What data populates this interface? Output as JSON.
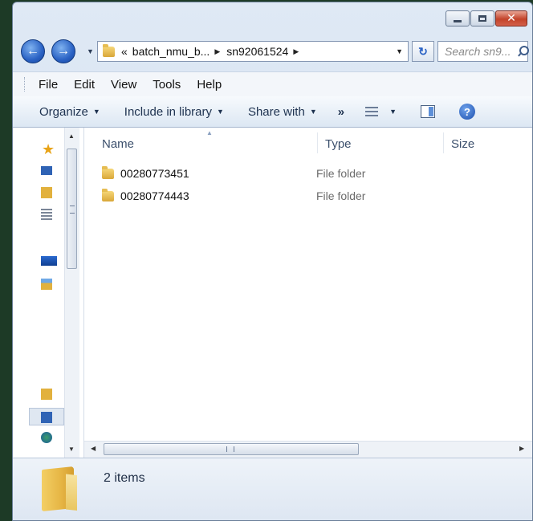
{
  "nav": {
    "back_label": "Back",
    "forward_label": "Forward",
    "breadcrumb_overflow": "«",
    "breadcrumbs": [
      "batch_nmu_b...",
      "sn92061524"
    ],
    "search_placeholder": "Search sn9..."
  },
  "menu": [
    "File",
    "Edit",
    "View",
    "Tools",
    "Help"
  ],
  "toolbar": {
    "organize": "Organize",
    "include_in_library": "Include in library",
    "share_with": "Share with",
    "more": "»"
  },
  "columns": {
    "name": "Name",
    "type": "Type",
    "size": "Size"
  },
  "files": [
    {
      "name": "00280773451",
      "type": "File folder"
    },
    {
      "name": "00280774443",
      "type": "File folder"
    }
  ],
  "details": {
    "item_count": "2 items"
  },
  "colors": {
    "window_frame": "#dfe9f5",
    "command_bar": "#dce7f3",
    "folder": "#e6b544",
    "close_button": "#c2432a"
  }
}
